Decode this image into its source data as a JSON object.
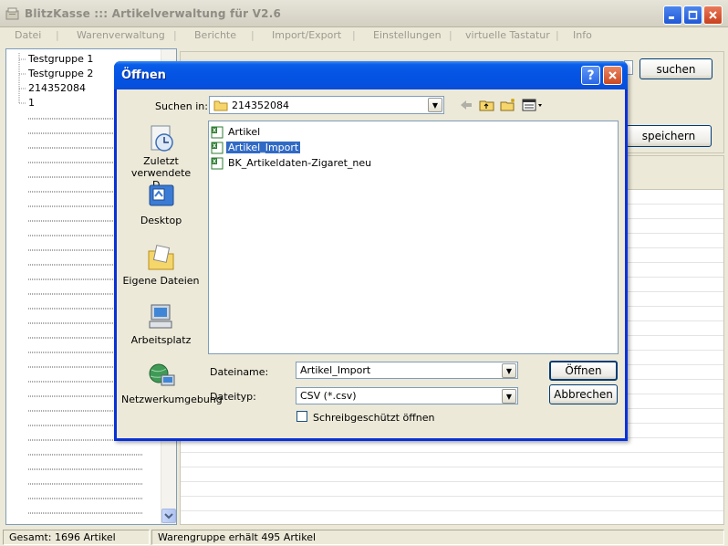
{
  "window": {
    "title": "BlitzKasse ::: Artikelverwaltung für V2.6"
  },
  "menu": [
    "Datei",
    "Warenverwaltung",
    "Berichte",
    "Import/Export",
    "Einstellungen",
    "virtuelle Tastatur",
    "Info"
  ],
  "tree": {
    "items": [
      "Testgruppe 1",
      "Testgruppe 2",
      "214352084",
      "1"
    ]
  },
  "main": {
    "search_label": "suchen",
    "save_label": "speichern"
  },
  "status": {
    "total": "Gesamt: 1696 Artikel",
    "group": "Warengruppe erhält 495 Artikel"
  },
  "dialog": {
    "title": "Öffnen",
    "help_label": "?",
    "look_in_label": "Suchen in:",
    "look_in_value": "214352084",
    "places": [
      {
        "label": "Zuletzt verwendete D...",
        "icon": "recent-documents-icon"
      },
      {
        "label": "Desktop",
        "icon": "desktop-icon"
      },
      {
        "label": "Eigene Dateien",
        "icon": "my-documents-icon"
      },
      {
        "label": "Arbeitsplatz",
        "icon": "my-computer-icon"
      },
      {
        "label": "Netzwerkumgebung",
        "icon": "network-icon"
      }
    ],
    "files": [
      "Artikel",
      "Artikel_Import",
      "BK_Artikeldaten-Zigaret_neu"
    ],
    "selected_file": "Artikel_Import",
    "filename_label": "Dateiname:",
    "filename_value": "Artikel_Import",
    "filetype_label": "Dateityp:",
    "filetype_value": "CSV (*.csv)",
    "readonly_label": "Schreibgeschützt öffnen",
    "open_label": "Öffnen",
    "cancel_label": "Abbrechen"
  },
  "colors": {
    "dialog_frame": "#0831d9",
    "selection": "#316ac5",
    "face": "#ece9d8"
  }
}
